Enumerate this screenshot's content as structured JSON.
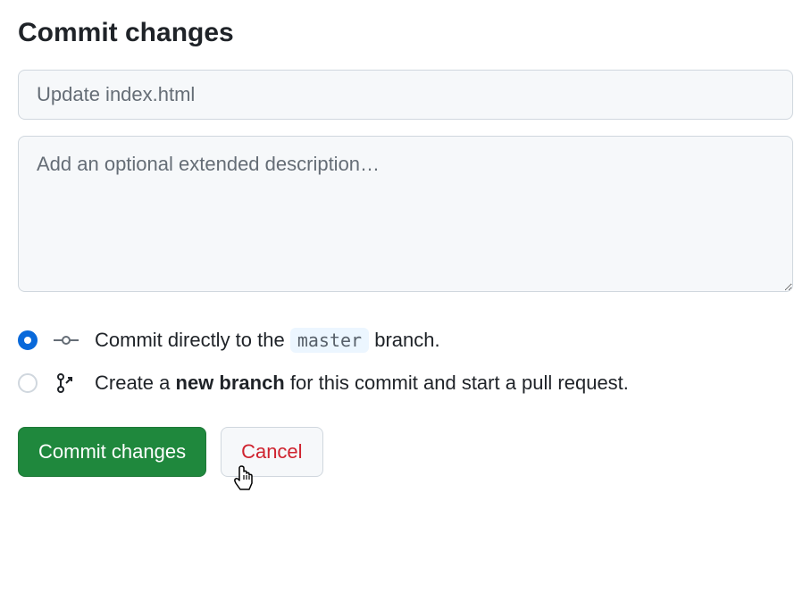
{
  "heading": "Commit changes",
  "summary": {
    "placeholder": "Update index.html",
    "value": ""
  },
  "description": {
    "placeholder": "Add an optional extended description…",
    "value": ""
  },
  "options": {
    "direct": {
      "prefix": "Commit directly to the ",
      "branch": "master",
      "suffix": " branch.",
      "selected": true
    },
    "newbranch": {
      "prefix": "Create a ",
      "strong": "new branch",
      "suffix": " for this commit and start a pull request.",
      "selected": false
    }
  },
  "buttons": {
    "commit": "Commit changes",
    "cancel": "Cancel"
  }
}
